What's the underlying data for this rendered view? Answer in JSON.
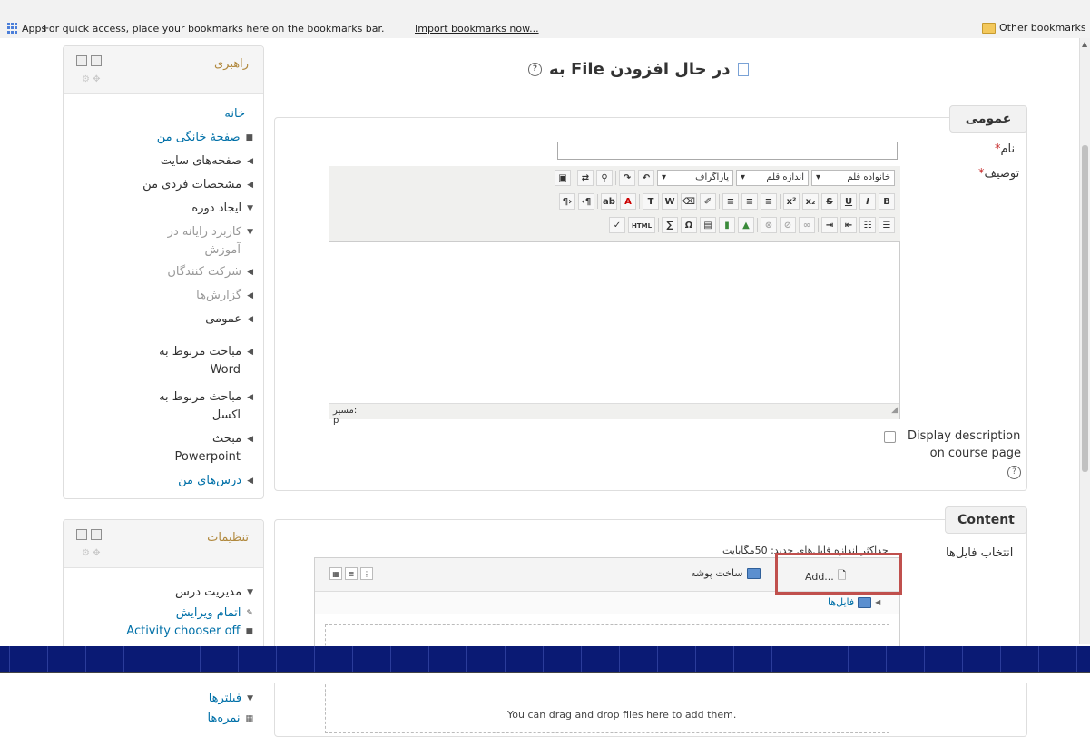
{
  "bookmarks_bar": {
    "apps_label": "Apps",
    "hint": "For quick access, place your bookmarks here on the bookmarks bar.",
    "import_link": "Import bookmarks now...",
    "other_bookmarks": "Other bookmarks"
  },
  "nav_block": {
    "title": "راهبری",
    "home": "خانه",
    "items": [
      {
        "label": "صفحهٔ خانگی من",
        "style": "link",
        "marker": "■"
      },
      {
        "label": "صفحه‌های سایت",
        "style": "normal",
        "marker": "◀"
      },
      {
        "label": "مشخصات فردی من",
        "style": "normal",
        "marker": "◀"
      },
      {
        "label": "ایجاد دوره",
        "style": "normal",
        "marker": "▼"
      },
      {
        "label": "کاربرد رایانه در",
        "style": "dim",
        "marker": "▼"
      },
      {
        "label": "آموزش",
        "style": "dim",
        "marker": ""
      },
      {
        "label": "شرکت کنندگان",
        "style": "dim",
        "marker": "◀"
      },
      {
        "label": "گزارش‌ها",
        "style": "dim",
        "marker": "◀"
      },
      {
        "label": "عمومی",
        "style": "normal",
        "marker": "◀"
      },
      {
        "label": "مباحث مربوط به",
        "style": "normal",
        "marker": "◀"
      },
      {
        "label": "Word",
        "style": "normal",
        "marker": ""
      },
      {
        "label": "مباحث مربوط به",
        "style": "normal",
        "marker": "◀"
      },
      {
        "label": "اکسل",
        "style": "normal",
        "marker": ""
      },
      {
        "label": "مبحث",
        "style": "normal",
        "marker": "◀"
      },
      {
        "label": "Powerpoint",
        "style": "normal",
        "marker": ""
      },
      {
        "label": "درس‌های من",
        "style": "link",
        "marker": "◀"
      }
    ]
  },
  "settings_block": {
    "title": "تنظیمات",
    "items": [
      {
        "label": "مدیریت درس",
        "style": "normal",
        "marker": "▼"
      },
      {
        "label": "اتمام ویرایش",
        "style": "link",
        "marker": "✎"
      },
      {
        "label": "Activity chooser off",
        "style": "link",
        "marker": "■"
      },
      {
        "label": "فیلترها",
        "style": "link",
        "marker": "▼"
      },
      {
        "label": "نمره‌ها",
        "style": "link",
        "marker": "▦"
      }
    ]
  },
  "page": {
    "heading": "در حال افزودن File به",
    "help": "?"
  },
  "general": {
    "legend": "عمومی",
    "name_label": "نام",
    "name_value": "",
    "desc_label": "توصیف",
    "required_mark": "*",
    "editor": {
      "font_family": "خانواده قلم",
      "font_size": "اندازه قلم",
      "paragraph": "پاراگراف",
      "path_label": "مسیر: p"
    },
    "display_desc_line1": "Display description",
    "display_desc_line2": "on course page",
    "display_desc_checked": false
  },
  "content": {
    "legend": "Content",
    "files_label": "انتخاب فایل‌ها",
    "max_size": "حداکثر اندازه فایل‌های جدید: 50مگابایت",
    "add_button": "Add...",
    "new_folder": "ساخت پوشه",
    "path_root": "فایل‌ها",
    "drop_hint": "You can drag and drop files here to add them."
  }
}
